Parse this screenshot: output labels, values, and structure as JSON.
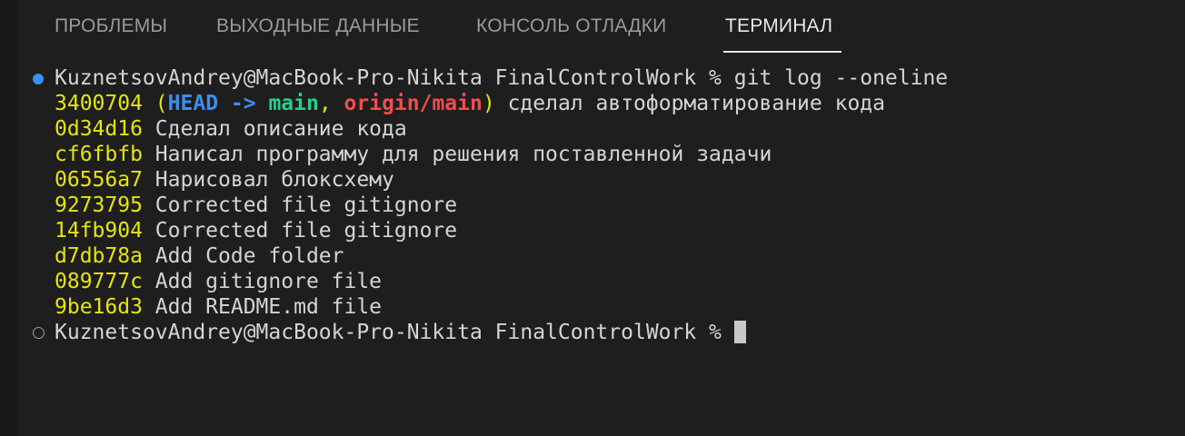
{
  "tabs": [
    {
      "label": "ПРОБЛЕМЫ"
    },
    {
      "label": "ВЫХОДНЫЕ ДАННЫЕ"
    },
    {
      "label": "КОНСОЛЬ ОТЛАДКИ"
    },
    {
      "label": "ТЕРМИНАЛ"
    }
  ],
  "active_tab": "ТЕРМИНАЛ",
  "terminal": {
    "command_prompt": "KuznetsovAndrey@MacBook-Pro-Nikita FinalControlWork % git log --oneline",
    "head_commit": {
      "hash": "3400704",
      "paren_open": "(",
      "head": "HEAD -> ",
      "main": "main",
      "comma": ", ",
      "origin": "origin/main",
      "paren_close": ")",
      "message": " сделал автоформатирование кода"
    },
    "commits": [
      {
        "hash": "0d34d16",
        "message": " Сделал описание кода"
      },
      {
        "hash": "cf6fbfb",
        "message": " Написал программу для решения поставленной задачи"
      },
      {
        "hash": "06556a7",
        "message": " Нарисовал блоксхему"
      },
      {
        "hash": "9273795",
        "message": " Corrected file gitignore"
      },
      {
        "hash": "14fb904",
        "message": " Corrected file gitignore"
      },
      {
        "hash": "d7db78a",
        "message": " Add Code folder"
      },
      {
        "hash": "089777c",
        "message": " Add gitignore file"
      },
      {
        "hash": "9be16d3",
        "message": " Add README.md file"
      }
    ],
    "final_prompt": "KuznetsovAndrey@MacBook-Pro-Nikita FinalControlWork % "
  },
  "colors": {
    "background": "#1e1e1e",
    "hash": "#e5e510",
    "head": "#3b8eea",
    "branch_main": "#23d18b",
    "branch_origin": "#f14c4c",
    "command_decoration": "#3794ff"
  }
}
